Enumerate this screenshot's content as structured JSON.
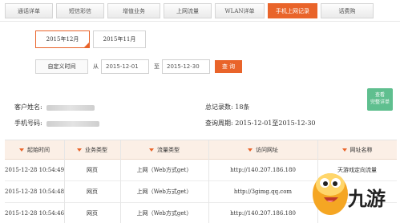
{
  "tabs": [
    {
      "label": "通话详单",
      "active": false
    },
    {
      "label": "短信彩信",
      "active": false
    },
    {
      "label": "增值业务",
      "active": false
    },
    {
      "label": "上网流量",
      "active": false
    },
    {
      "label": "WLAN详单",
      "active": false
    },
    {
      "label": "手机上网记录",
      "active": true
    },
    {
      "label": "话费购",
      "active": false
    }
  ],
  "months": [
    {
      "label": "2015年12月",
      "active": true
    },
    {
      "label": "2015年11月",
      "active": false
    }
  ],
  "filter": {
    "custom_label": "自定义时间",
    "from_label": "从",
    "from_value": "2015-12-01",
    "to_label": "至",
    "to_value": "2015-12-30",
    "query_label": "查 询"
  },
  "side_badge": {
    "line1": "查看",
    "line2": "完整详单"
  },
  "info": {
    "customer_label": "客户姓名:",
    "phone_label": "手机号码:",
    "count_label": "总记录数: ",
    "count_value": "18条",
    "period_label": "查询周期: ",
    "period_value": "2015-12-01至2015-12-30"
  },
  "table": {
    "headers": [
      "起始时间",
      "业务类型",
      "流量类型",
      "访问网址",
      "网址名称"
    ],
    "rows": [
      [
        "2015-12-28 10:54:49",
        "网页",
        "上网（Web方式get）",
        "http://140.207.186.180",
        "天游戏定向流量"
      ],
      [
        "2015-12-28 10:54:48",
        "网页",
        "上网（Web方式get）",
        "http://3gimg.qq.com",
        ""
      ],
      [
        "2015-12-28 10:54:46",
        "网页",
        "上网（Web方式get）",
        "http://140.207.186.180",
        ""
      ]
    ]
  },
  "watermark": {
    "text": "九游"
  },
  "colors": {
    "accent": "#e9642a",
    "header_bg": "#fbefe6",
    "badge": "#5fbf8f"
  }
}
